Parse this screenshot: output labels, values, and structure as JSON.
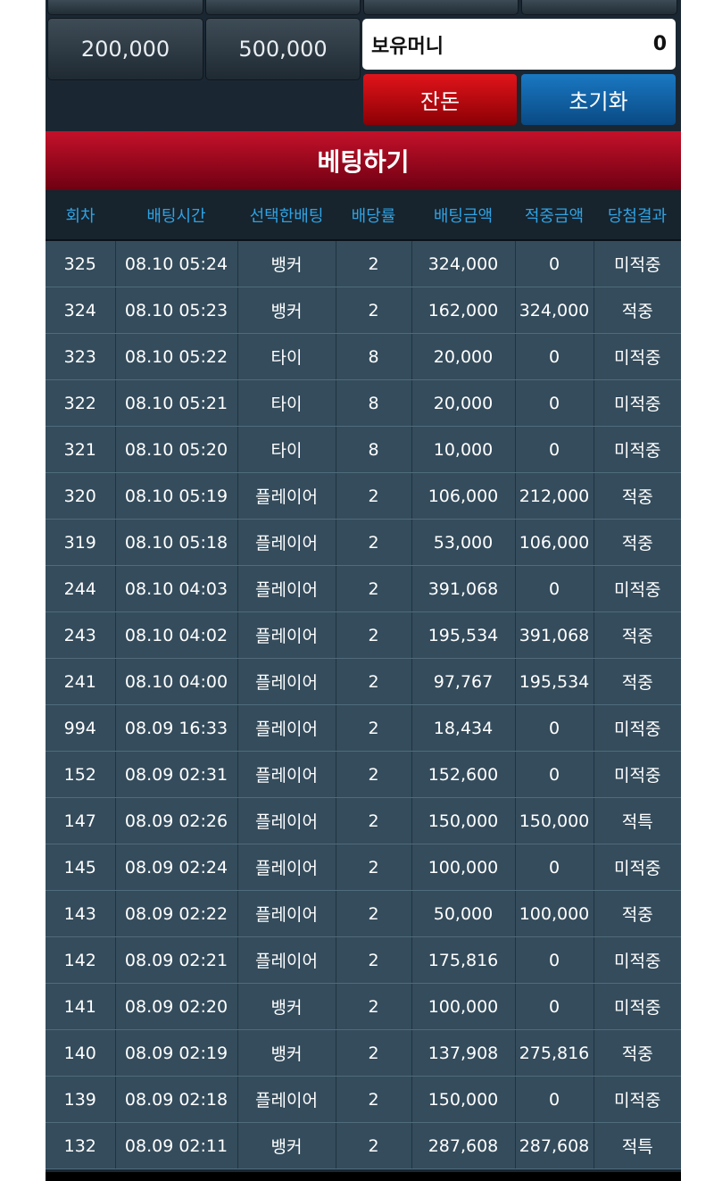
{
  "controls": {
    "chip_200k": "200,000",
    "chip_500k": "500,000",
    "money_label": "보유머니",
    "money_value": "0",
    "balance_button": "잔돈",
    "reset_button": "초기화"
  },
  "banner_title": "베팅하기",
  "table": {
    "headers": [
      "회차",
      "배팅시간",
      "선택한배팅",
      "배당률",
      "배팅금액",
      "적중금액",
      "당첨결과"
    ],
    "rows": [
      [
        "325",
        "08.10 05:24",
        "뱅커",
        "2",
        "324,000",
        "0",
        "미적중"
      ],
      [
        "324",
        "08.10 05:23",
        "뱅커",
        "2",
        "162,000",
        "324,000",
        "적중"
      ],
      [
        "323",
        "08.10 05:22",
        "타이",
        "8",
        "20,000",
        "0",
        "미적중"
      ],
      [
        "322",
        "08.10 05:21",
        "타이",
        "8",
        "20,000",
        "0",
        "미적중"
      ],
      [
        "321",
        "08.10 05:20",
        "타이",
        "8",
        "10,000",
        "0",
        "미적중"
      ],
      [
        "320",
        "08.10 05:19",
        "플레이어",
        "2",
        "106,000",
        "212,000",
        "적중"
      ],
      [
        "319",
        "08.10 05:18",
        "플레이어",
        "2",
        "53,000",
        "106,000",
        "적중"
      ],
      [
        "244",
        "08.10 04:03",
        "플레이어",
        "2",
        "391,068",
        "0",
        "미적중"
      ],
      [
        "243",
        "08.10 04:02",
        "플레이어",
        "2",
        "195,534",
        "391,068",
        "적중"
      ],
      [
        "241",
        "08.10 04:00",
        "플레이어",
        "2",
        "97,767",
        "195,534",
        "적중"
      ],
      [
        "994",
        "08.09 16:33",
        "플레이어",
        "2",
        "18,434",
        "0",
        "미적중"
      ],
      [
        "152",
        "08.09 02:31",
        "플레이어",
        "2",
        "152,600",
        "0",
        "미적중"
      ],
      [
        "147",
        "08.09 02:26",
        "플레이어",
        "2",
        "150,000",
        "150,000",
        "적특"
      ],
      [
        "145",
        "08.09 02:24",
        "플레이어",
        "2",
        "100,000",
        "0",
        "미적중"
      ],
      [
        "143",
        "08.09 02:22",
        "플레이어",
        "2",
        "50,000",
        "100,000",
        "적중"
      ],
      [
        "142",
        "08.09 02:21",
        "플레이어",
        "2",
        "175,816",
        "0",
        "미적중"
      ],
      [
        "141",
        "08.09 02:20",
        "뱅커",
        "2",
        "100,000",
        "0",
        "미적중"
      ],
      [
        "140",
        "08.09 02:19",
        "뱅커",
        "2",
        "137,908",
        "275,816",
        "적중"
      ],
      [
        "139",
        "08.09 02:18",
        "플레이어",
        "2",
        "150,000",
        "0",
        "미적중"
      ],
      [
        "132",
        "08.09 02:11",
        "뱅커",
        "2",
        "287,608",
        "287,608",
        "적특"
      ]
    ]
  },
  "colors": {
    "result_miss": "#d81c1c",
    "result_hit": "#15852b",
    "result_special": "#f3a32a"
  }
}
